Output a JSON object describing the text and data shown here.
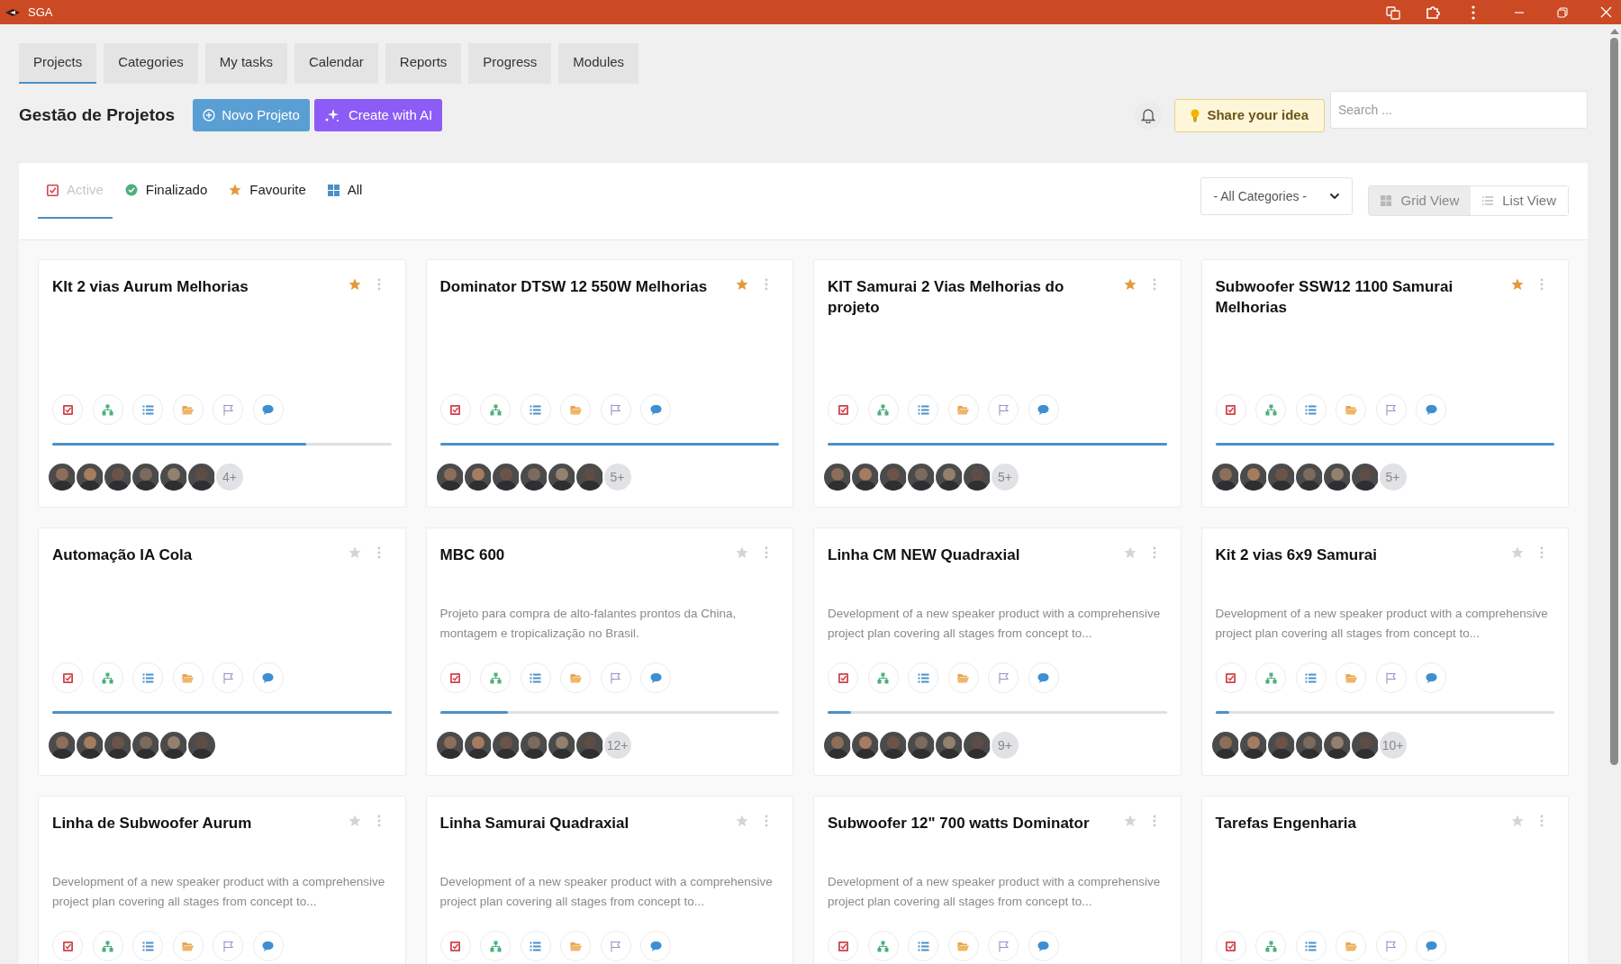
{
  "window": {
    "title": "SGA"
  },
  "nav_tabs": [
    {
      "label": "Projects",
      "selected": true
    },
    {
      "label": "Categories",
      "selected": false
    },
    {
      "label": "My tasks",
      "selected": false
    },
    {
      "label": "Calendar",
      "selected": false
    },
    {
      "label": "Reports",
      "selected": false
    },
    {
      "label": "Progress",
      "selected": false
    },
    {
      "label": "Modules",
      "selected": false
    }
  ],
  "header": {
    "title": "Gestão de Projetos",
    "buttons": [
      {
        "label": "Novo Projeto",
        "kind": "new"
      },
      {
        "label": "Create with AI",
        "kind": "ai"
      }
    ],
    "idea_button": "Share your idea",
    "search": {
      "placeholder": "Search ..."
    }
  },
  "filters": [
    {
      "label": "Active",
      "kind": "active",
      "selected": true
    },
    {
      "label": "Finalizado",
      "kind": "done",
      "selected": false
    },
    {
      "label": "Favourite",
      "kind": "favourite",
      "selected": false
    },
    {
      "label": "All",
      "kind": "all",
      "selected": false
    }
  ],
  "category_select": {
    "value": "- All Categories -"
  },
  "views": [
    {
      "label": "Grid View",
      "kind": "grid",
      "selected": true
    },
    {
      "label": "List View",
      "kind": "list",
      "selected": false
    }
  ],
  "projects": [
    {
      "title": "KIt 2 vias Aurum Melhorias",
      "favourite": true,
      "level": 0.75,
      "members": [
        {
          "kind": "avatar"
        },
        {
          "kind": "avatar"
        },
        {
          "kind": "avatar"
        },
        {
          "kind": "avatar"
        },
        {
          "kind": "avatar"
        },
        {
          "kind": "avatar"
        }
      ],
      "more": "4+"
    },
    {
      "title": "Dominator DTSW 12 550W Melhorias",
      "favourite": true,
      "level": 1,
      "members": [
        {
          "kind": "avatar"
        },
        {
          "kind": "avatar"
        },
        {
          "kind": "avatar"
        },
        {
          "kind": "avatar"
        },
        {
          "kind": "avatar"
        },
        {
          "kind": "avatar"
        }
      ],
      "more": "5+"
    },
    {
      "title": "KIT Samurai 2 Vias Melhorias do projeto",
      "favourite": true,
      "level": 1,
      "members": [
        {
          "kind": "avatar"
        },
        {
          "kind": "avatar"
        },
        {
          "kind": "avatar"
        },
        {
          "kind": "avatar"
        },
        {
          "kind": "avatar"
        },
        {
          "kind": "avatar"
        }
      ],
      "more": "5+"
    },
    {
      "title": "Subwoofer SSW12 1100 Samurai Melhorias",
      "favourite": true,
      "level": 1,
      "members": [
        {
          "kind": "avatar"
        },
        {
          "kind": "avatar"
        },
        {
          "kind": "avatar"
        },
        {
          "kind": "avatar"
        },
        {
          "kind": "avatar"
        },
        {
          "kind": "avatar"
        }
      ],
      "more": "5+"
    },
    {
      "title": "Automação IA Cola",
      "favourite": false,
      "level": 1,
      "members": [
        {
          "kind": "avatar"
        },
        {
          "kind": "avatar"
        },
        {
          "kind": "avatar"
        },
        {
          "kind": "avatar"
        },
        {
          "kind": "avatar"
        },
        {
          "kind": "avatar"
        }
      ]
    },
    {
      "title": "MBC 600",
      "favourite": false,
      "description": "Projeto para compra de alto-falantes prontos da China, montagem e tropicalização no Brasil.",
      "level": 0.2,
      "members": [
        {
          "kind": "avatar"
        },
        {
          "kind": "avatar"
        },
        {
          "kind": "avatar"
        },
        {
          "kind": "avatar"
        },
        {
          "kind": "avatar"
        },
        {
          "kind": "avatar"
        }
      ],
      "more": "12+"
    },
    {
      "title": "Linha CM NEW Quadraxial",
      "favourite": false,
      "description": "Development of a new speaker product with a comprehensive project plan covering all stages from concept to...",
      "level": 0.07,
      "members": [
        {
          "kind": "avatar"
        },
        {
          "kind": "avatar"
        },
        {
          "kind": "avatar"
        },
        {
          "kind": "avatar"
        },
        {
          "kind": "avatar"
        },
        {
          "kind": "avatar"
        }
      ],
      "more": "9+"
    },
    {
      "title": "Kit 2 vias 6x9 Samurai",
      "favourite": false,
      "description": "Development of a new speaker product with a comprehensive project plan covering all stages from concept to...",
      "level": 0.04,
      "members": [
        {
          "kind": "avatar"
        },
        {
          "kind": "avatar"
        },
        {
          "kind": "avatar"
        },
        {
          "kind": "avatar"
        },
        {
          "kind": "avatar"
        },
        {
          "kind": "avatar"
        }
      ],
      "more": "10+"
    },
    {
      "title": "Linha de Subwoofer Aurum",
      "favourite": false,
      "description": "Development of a new speaker product with a comprehensive project plan covering all stages from concept to..."
    },
    {
      "title": "Linha Samurai Quadraxial",
      "favourite": false,
      "description": "Development of a new speaker product with a comprehensive project plan covering all stages from concept to..."
    },
    {
      "title": "Subwoofer 12\" 700 watts Dominator",
      "favourite": false,
      "description": "Development of a new speaker product with a comprehensive project plan covering all stages from concept to..."
    },
    {
      "title": "Tarefas Engenharia",
      "favourite": false
    }
  ]
}
